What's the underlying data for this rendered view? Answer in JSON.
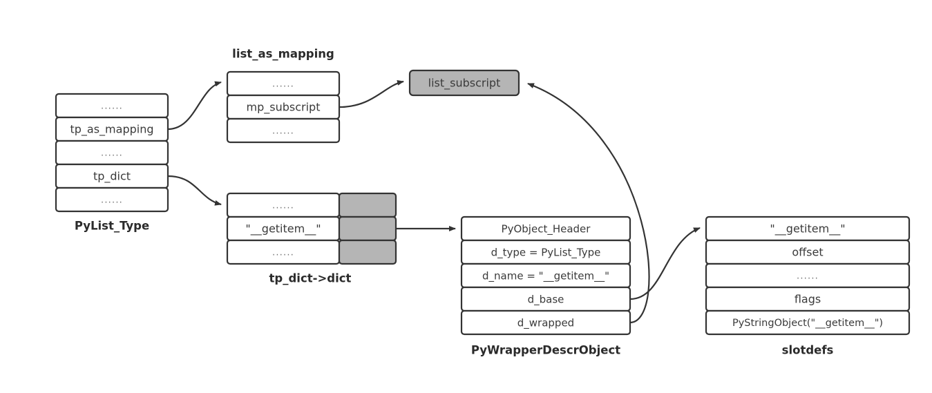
{
  "diagram": {
    "title": "CPython list __getitem__ slot resolution diagram",
    "colors": {
      "stroke": "#333333",
      "cell_fill": "#ffffff",
      "gray_fill": "#b5b5b5",
      "text": "#3a3a3a",
      "label": "#2b2b2b",
      "ellipsis": "#6d6d6d"
    },
    "ellipsis_glyph": "......",
    "boxes": {
      "pylist_type": {
        "label": "PyList_Type",
        "rows": [
          {
            "text": "......",
            "kind": "ellipsis"
          },
          {
            "text": "tp_as_mapping",
            "kind": "field"
          },
          {
            "text": "......",
            "kind": "ellipsis"
          },
          {
            "text": "tp_dict",
            "kind": "field"
          },
          {
            "text": "......",
            "kind": "ellipsis"
          }
        ]
      },
      "list_as_mapping": {
        "label": "list_as_mapping",
        "rows": [
          {
            "text": "......",
            "kind": "ellipsis"
          },
          {
            "text": "mp_subscript",
            "kind": "field"
          },
          {
            "text": "......",
            "kind": "ellipsis"
          }
        ]
      },
      "list_subscript": {
        "label": "",
        "rows": [
          {
            "text": "list_subscript",
            "kind": "field"
          }
        ]
      },
      "tp_dict_dict": {
        "label": "tp_dict->dict",
        "rows": [
          {
            "text": "......",
            "kind": "ellipsis"
          },
          {
            "text": "\"__getitem__\"",
            "kind": "field"
          },
          {
            "text": "......",
            "kind": "ellipsis"
          }
        ],
        "value_column": [
          {
            "text": "",
            "kind": "gray"
          },
          {
            "text": "",
            "kind": "gray"
          },
          {
            "text": "",
            "kind": "gray"
          }
        ]
      },
      "pywrapperdescrobject": {
        "label": "PyWrapperDescrObject",
        "rows": [
          {
            "text": "PyObject_Header",
            "kind": "field"
          },
          {
            "text": "d_type = PyList_Type",
            "kind": "field"
          },
          {
            "text": "d_name = \"__getitem__\"",
            "kind": "field"
          },
          {
            "text": "d_base",
            "kind": "field"
          },
          {
            "text": "d_wrapped",
            "kind": "field"
          }
        ]
      },
      "slotdefs": {
        "label": "slotdefs",
        "rows": [
          {
            "text": "\"__getitem__\"",
            "kind": "field"
          },
          {
            "text": "offset",
            "kind": "field"
          },
          {
            "text": "......",
            "kind": "ellipsis"
          },
          {
            "text": "flags",
            "kind": "field"
          },
          {
            "text": "PyStringObject(\"__getitem__\")",
            "kind": "field"
          }
        ]
      }
    },
    "connectors": [
      {
        "name": "tp-as-mapping-to-list-as-mapping",
        "from": "tp_as_mapping",
        "to": "list_as_mapping"
      },
      {
        "name": "tp-dict-to-tp-dict-dict",
        "from": "tp_dict",
        "to": "tp_dict->dict"
      },
      {
        "name": "mp-subscript-to-list-subscript",
        "from": "mp_subscript",
        "to": "list_subscript"
      },
      {
        "name": "dict-value-to-wrapperdescr",
        "from": "tp_dict->dict",
        "to": "PyWrapperDescrObject"
      },
      {
        "name": "d-base-to-slotdefs",
        "from": "d_base",
        "to": "slotdefs"
      },
      {
        "name": "d-wrapped-to-list-subscript",
        "from": "d_wrapped",
        "to": "list_subscript"
      }
    ]
  }
}
